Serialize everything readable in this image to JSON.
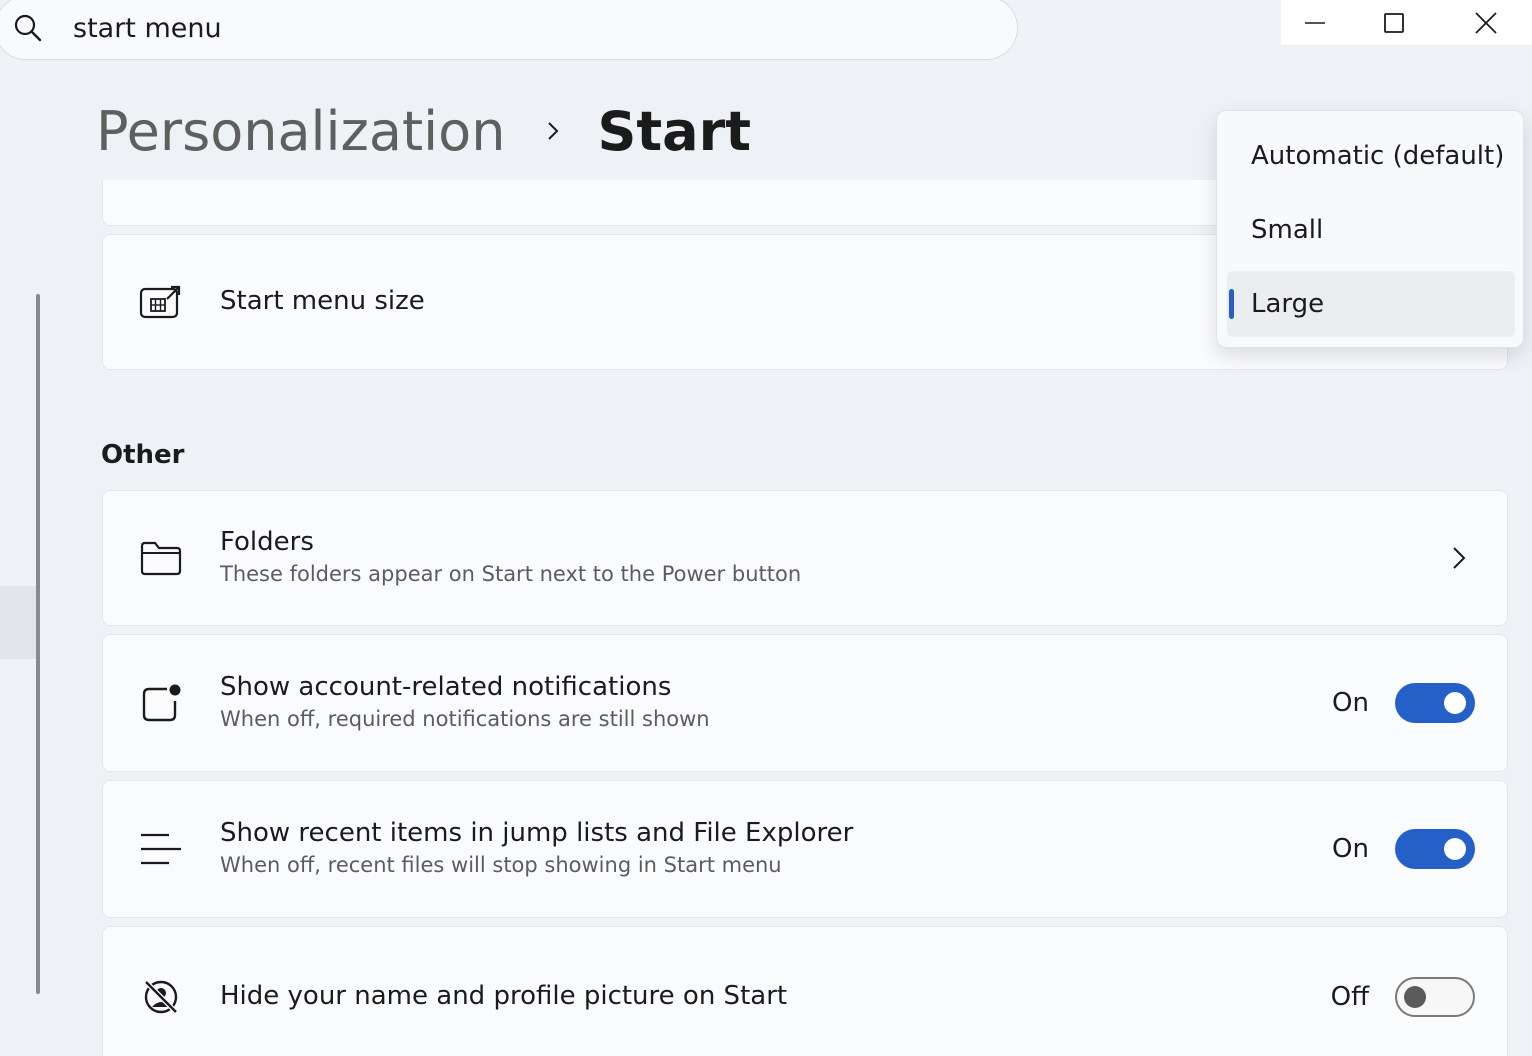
{
  "search": {
    "value": "start menu"
  },
  "breadcrumb": {
    "parent": "Personalization",
    "current": "Start"
  },
  "start_menu_size": {
    "title": "Start menu size",
    "options": [
      "Automatic (default)",
      "Small",
      "Large"
    ],
    "selected": "Large"
  },
  "other": {
    "header": "Other",
    "folders": {
      "title": "Folders",
      "desc": "These folders appear on Start next to the Power button"
    },
    "account_notifications": {
      "title": "Show account-related notifications",
      "desc": "When off, required notifications are still shown",
      "state": "On"
    },
    "recent_items": {
      "title": "Show recent items in jump lists and File Explorer",
      "desc": "When off, recent files will stop showing in Start menu",
      "state": "On"
    },
    "hide_name": {
      "title": "Hide your name and profile picture on Start",
      "state": "Off"
    }
  },
  "colors": {
    "accent": "#2460c8",
    "background": "#eef2f7",
    "card": "#fafbfd"
  },
  "icons": {
    "search": "search-icon",
    "minimize": "minimize-icon",
    "maximize": "maximize-icon",
    "close": "close-icon",
    "start_menu_size": "resize-icon",
    "folders": "folder-icon",
    "account_notifications": "notification-badge-icon",
    "recent_items": "list-icon",
    "hide_name": "hidden-profile-icon"
  }
}
